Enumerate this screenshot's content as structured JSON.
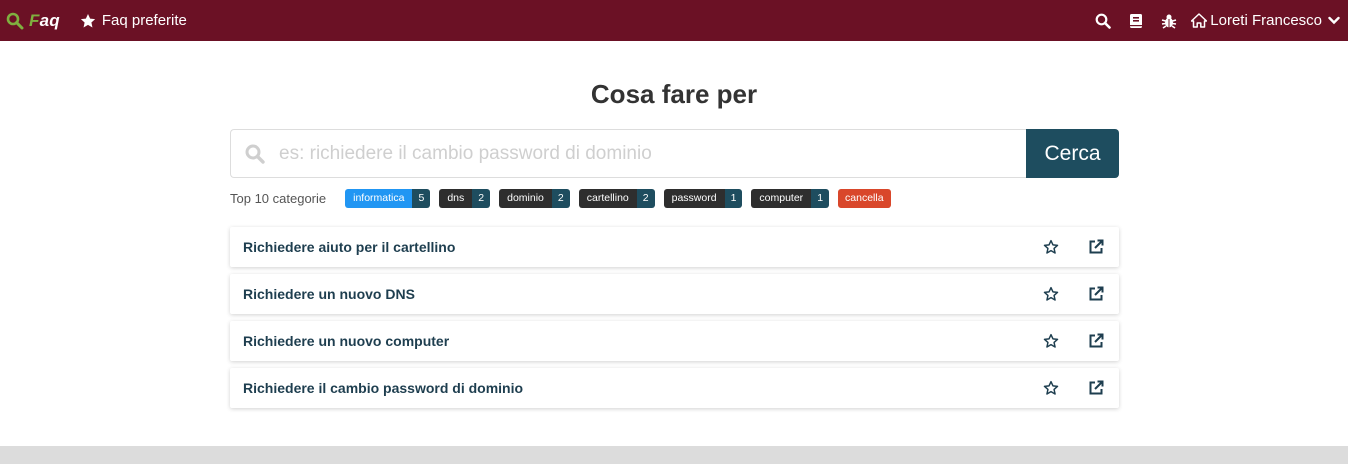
{
  "navbar": {
    "brand_f": "F",
    "brand_rest": "aq",
    "favorites_label": "Faq preferite",
    "user_name": "Loreti Francesco",
    "icons": [
      "search-icon",
      "book-icon",
      "bug-icon",
      "home-icon",
      "chevron-down-icon"
    ]
  },
  "main": {
    "title": "Cosa fare per",
    "search": {
      "placeholder": "es: richiedere il cambio password di dominio",
      "value": "",
      "button_label": "Cerca"
    },
    "categories": {
      "label": "Top 10 categorie",
      "tags": [
        {
          "name": "informatica",
          "count": "5"
        },
        {
          "name": "dns",
          "count": "2"
        },
        {
          "name": "dominio",
          "count": "2"
        },
        {
          "name": "cartellino",
          "count": "2"
        },
        {
          "name": "password",
          "count": "1"
        },
        {
          "name": "computer",
          "count": "1"
        }
      ],
      "clear_label": "cancella"
    },
    "faqs": [
      {
        "title": "Richiedere aiuto per il cartellino"
      },
      {
        "title": "Richiedere un nuovo DNS"
      },
      {
        "title": "Richiedere un nuovo computer"
      },
      {
        "title": "Richiedere il cambio password di dominio"
      }
    ]
  },
  "colors": {
    "navbar": "#6b1125",
    "accent": "#1e4d5f",
    "brand_green": "#7fb03f",
    "tag_blue": "#2196f3",
    "tag_dark": "#2e2e2e",
    "tag_red": "#d9472b"
  }
}
